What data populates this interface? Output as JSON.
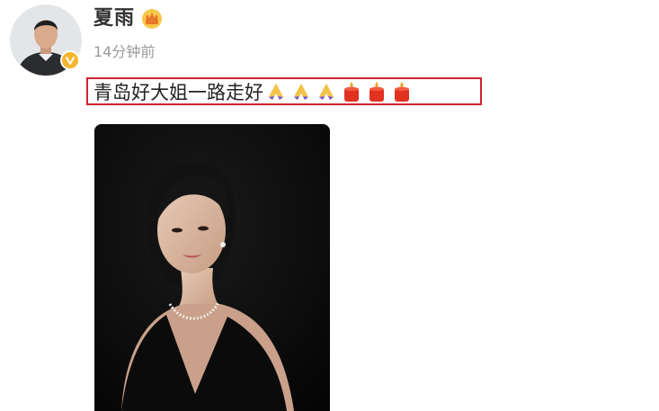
{
  "post": {
    "username": "夏雨",
    "time": "14分钟前",
    "text": "青岛好大姐一路走好",
    "emojis": [
      "pray-icon",
      "pray-icon",
      "pray-icon",
      "candle-icon",
      "candle-icon",
      "candle-icon"
    ]
  },
  "colors": {
    "highlight_border": "#d0232e",
    "verified_badge": "#f5b52d",
    "time_text": "#9a9a9a"
  }
}
